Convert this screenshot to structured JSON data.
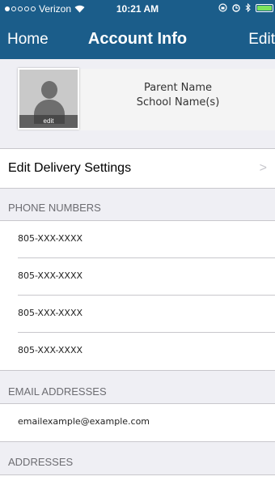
{
  "status_bar": {
    "carrier": "Verizon",
    "time": "10:21 AM",
    "battery_color": "#7ce35d"
  },
  "nav": {
    "home_label": "Home",
    "title": "Account Info",
    "edit_label": "Edit",
    "bar_color": "#1b5d8a"
  },
  "profile": {
    "avatar_edit_label": "edit",
    "parent_name": "Parent Name",
    "school_names": "School Name(s)"
  },
  "delivery": {
    "label": "Edit Delivery Settings",
    "chevron": ">"
  },
  "phone_numbers": {
    "header": "PHONE NUMBERS",
    "items": [
      "805-XXX-XXXX",
      "805-XXX-XXXX",
      "805-XXX-XXXX",
      "805-XXX-XXXX"
    ]
  },
  "email_addresses": {
    "header": "EMAIL ADDRESSES",
    "items": [
      "emailexample@example.com"
    ]
  },
  "addresses": {
    "header": "ADDRESSES"
  }
}
